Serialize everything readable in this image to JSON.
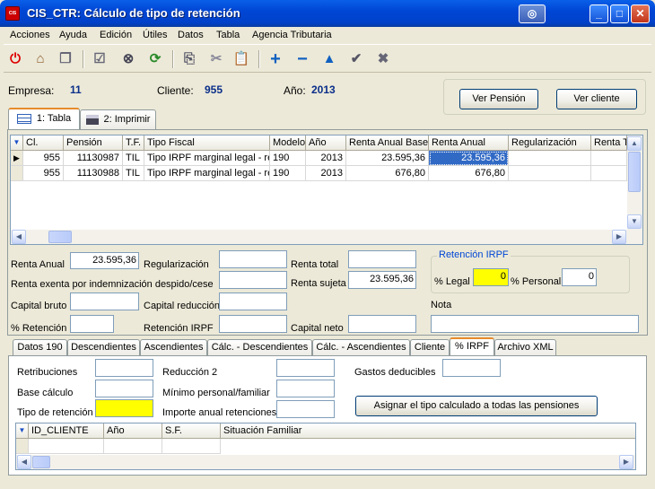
{
  "window": {
    "title": "CIS_CTR: Cálculo de tipo de retención",
    "app_icon": "CIS"
  },
  "menu": [
    "Acciones",
    "Ayuda",
    "Edición",
    "Útiles",
    "Datos",
    "Tabla",
    "Agencia Tributaria"
  ],
  "header": {
    "empresa_label": "Empresa:",
    "empresa_value": "11",
    "cliente_label": "Cliente:",
    "cliente_value": "955",
    "anio_label": "Año:",
    "anio_value": "2013",
    "ver_pension": "Ver Pensión",
    "ver_cliente": "Ver cliente"
  },
  "main_tabs": [
    "1: Tabla",
    "2: Imprimir"
  ],
  "grid": {
    "columns": [
      "Cl.",
      "Pensión",
      "T.F.",
      "Tipo Fiscal",
      "Modelo",
      "Año",
      "Renta Anual Base",
      "Renta Anual",
      "Regularización",
      "Renta T"
    ],
    "rows": [
      [
        "955",
        "11130987",
        "TIL",
        "Tipo IRPF marginal legal - rend.",
        "190",
        "2013",
        "23.595,36",
        "23.595,36",
        ""
      ],
      [
        "955",
        "11130988",
        "TIL",
        "Tipo IRPF marginal legal - rend.",
        "190",
        "2013",
        "676,80",
        "676,80",
        ""
      ]
    ]
  },
  "form": {
    "renta_anual_label": "Renta Anual",
    "renta_anual": "23.595,36",
    "regularizacion_label": "Regularización",
    "regularizacion": "",
    "renta_total_label": "Renta total",
    "renta_total": "",
    "renta_exenta_label": "Renta exenta por indemnización despido/cese",
    "renta_exenta": "",
    "renta_sujeta_label": "Renta sujeta",
    "renta_sujeta": "23.595,36",
    "capital_bruto_label": "Capital bruto",
    "capital_bruto": "",
    "capital_reduccion_label": "Capital reducción",
    "capital_reduccion": "",
    "retencion_label": "% Retención",
    "retencion": "",
    "retencion_irpf_label": "Retención IRPF",
    "retencion_irpf": "",
    "capital_neto_label": "Capital neto",
    "capital_neto": "",
    "nota_label": "Nota",
    "nota": "",
    "group_title": "Retención IRPF",
    "legal_label": "% Legal",
    "legal": "0",
    "personal_label": "% Personal",
    "personal": "0"
  },
  "sub_tabs": [
    "Datos 190",
    "Descendientes",
    "Ascendientes",
    "Cálc. - Descendientes",
    "Cálc. - Ascendientes",
    "Cliente",
    "% IRPF",
    "Archivo XML"
  ],
  "irpf": {
    "retribuciones_label": "Retribuciones",
    "retribuciones": "",
    "reduccion2_label": "Reducción 2",
    "reduccion2": "",
    "gastos_label": "Gastos deducibles",
    "gastos": "",
    "base_calculo_label": "Base cálculo",
    "base_calculo": "",
    "minimo_label": "Mínimo personal/familiar",
    "minimo": "",
    "tipo_retencion_label": "Tipo de retención",
    "tipo_retencion": "",
    "importe_label": "Importe anual retenciones",
    "importe": "",
    "asignar_button": "Asignar el tipo calculado a todas las pensiones"
  },
  "subgrid": {
    "columns": [
      "ID_CLIENTE",
      "Año",
      "S.F.",
      "Situación Familiar"
    ]
  },
  "colors": {
    "title_blue": "#0046D5",
    "selection": "#316ac5",
    "yellow_field": "#ffff00",
    "label_blue": "#0b2f8a"
  }
}
